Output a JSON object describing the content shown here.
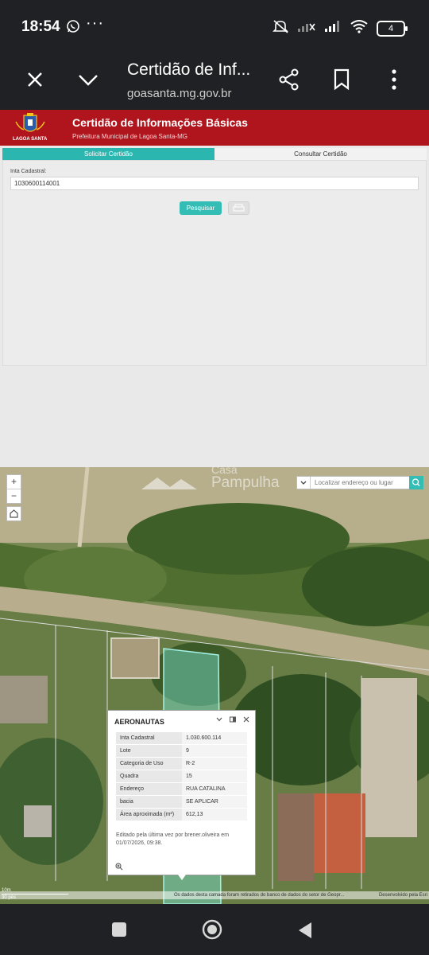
{
  "status_bar": {
    "time": "18:54",
    "battery": "4",
    "icons": [
      "whatsapp-icon",
      "more-dots-icon",
      "mute-icon",
      "signal-x-icon",
      "signal-icon",
      "wifi-icon",
      "battery-icon"
    ]
  },
  "browser": {
    "title": "Certidão de Inf...",
    "url": "goasanta.mg.gov.br",
    "icons": [
      "close-icon",
      "chevron-down-icon",
      "share-icon",
      "bookmark-icon",
      "more-vert-icon"
    ]
  },
  "site": {
    "logo_caption": "LAGOA SANTA",
    "title": "Certidão de Informações Básicas",
    "subtitle": "Prefeitura Municipal de Lagoa Santa-MG",
    "brand_color": "#b0141c",
    "accent_color": "#33bdb4"
  },
  "tabs": [
    {
      "label": "Solicitar Certidão",
      "active": true
    },
    {
      "label": "Consultar Certidão",
      "active": false
    }
  ],
  "form": {
    "field_label": "Inta Cadastral:",
    "field_value": "1030600114001",
    "search_button": "Pesquisar"
  },
  "map": {
    "watermark_line1": "Casa",
    "watermark_line2": "Pampulha",
    "search_placeholder": "Localizar endereço ou lugar",
    "zoom_in": "+",
    "zoom_out": "−",
    "scale_metric": "10m",
    "scale_imperial": "30 pés",
    "attribution_left": "Os dados desta camada foram retirados do banco de dados do setor de Geopr...",
    "attribution_right": "Desenvolvido pela Esri",
    "popup": {
      "title": "AERONAUTAS",
      "rows": [
        {
          "key": "Inta Cadastral",
          "value": "1.030.600.114"
        },
        {
          "key": "Lote",
          "value": "9"
        },
        {
          "key": "Categoria de Uso",
          "value": "R-2"
        },
        {
          "key": "Quadra",
          "value": "15"
        },
        {
          "key": "Endereço",
          "value": "RUA CATALINA"
        },
        {
          "key": "bacia",
          "value": "SE APLICAR"
        },
        {
          "key": "Área aproximada (m²)",
          "value": "612,13"
        }
      ],
      "footer": "Editado pela última vez por brener.oliveira em 01/07/2026, 09:38."
    }
  }
}
